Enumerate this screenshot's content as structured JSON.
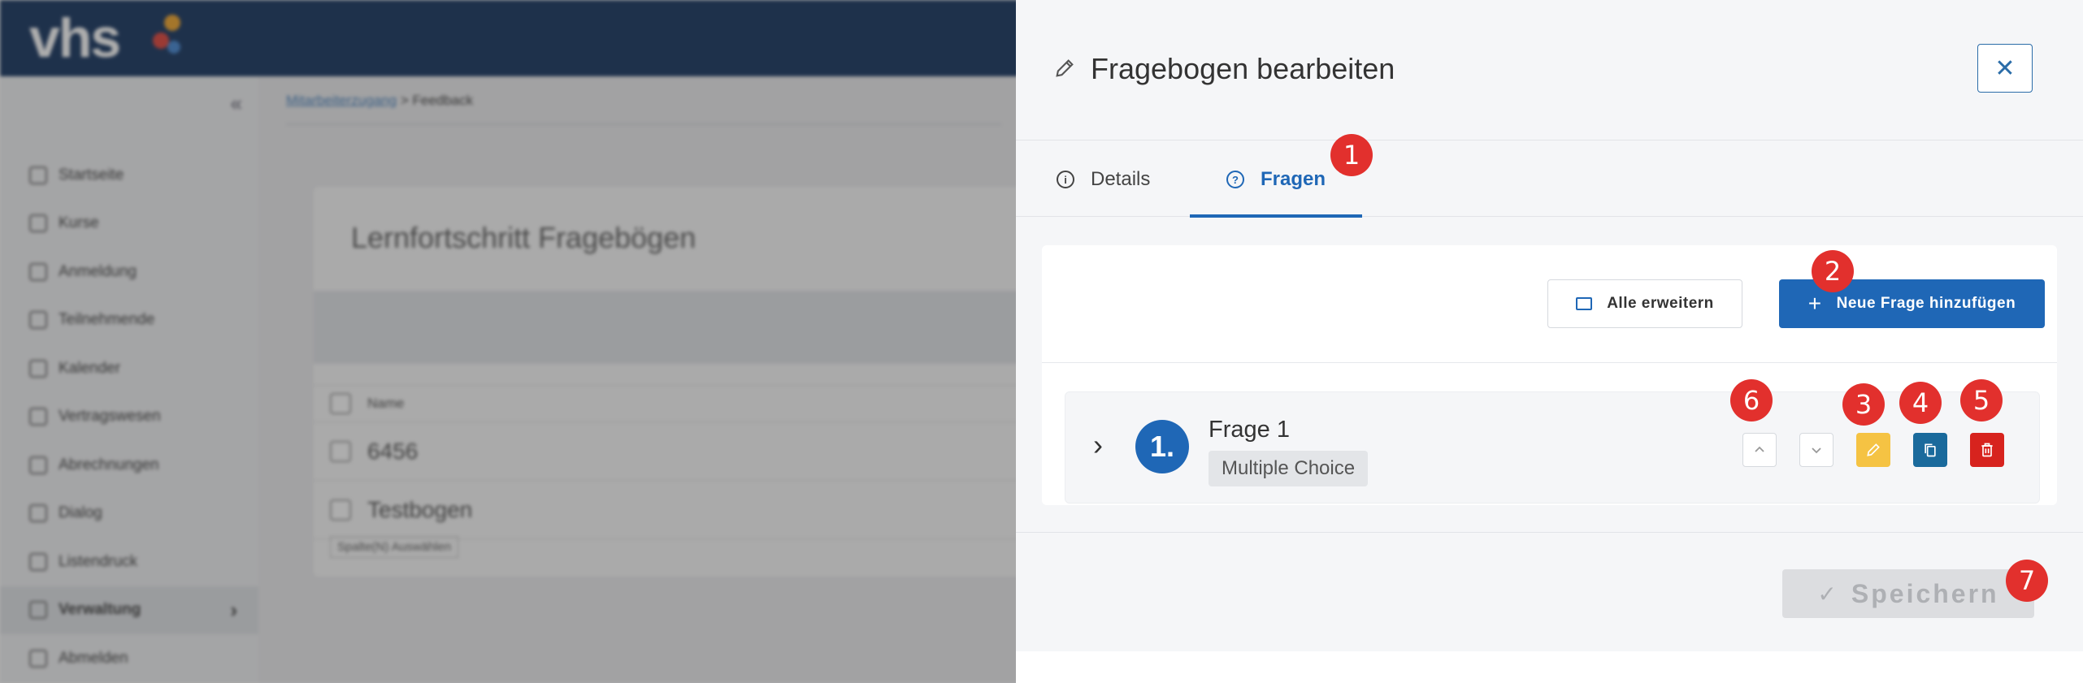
{
  "background": {
    "logo": "vhs",
    "breadcrumb": {
      "parent": "Mitarbeiterzugang",
      "separator": ">",
      "current": "Feedback"
    },
    "sidebar": [
      {
        "label": "Startseite",
        "active": false
      },
      {
        "label": "Kurse",
        "active": false
      },
      {
        "label": "Anmeldung",
        "active": false
      },
      {
        "label": "Teilnehmende",
        "active": false
      },
      {
        "label": "Kalender",
        "active": false
      },
      {
        "label": "Vertragswesen",
        "active": false
      },
      {
        "label": "Abrechnungen",
        "active": false
      },
      {
        "label": "Dialog",
        "active": false
      },
      {
        "label": "Listendruck",
        "active": false
      },
      {
        "label": "Verwaltung",
        "active": true
      },
      {
        "label": "Abmelden",
        "active": false
      }
    ],
    "card_title": "Lernfortschritt Fragebögen",
    "table": {
      "header": "Name",
      "rows": [
        "6456",
        "Testbogen"
      ],
      "footer": "Spalte(N) Auswählen"
    }
  },
  "panel": {
    "title": "Fragebogen bearbeiten",
    "close_symbol": "✕",
    "tabs": {
      "details": "Details",
      "fragen": "Fragen"
    },
    "buttons": {
      "expand_all": "Alle erweitern",
      "add_question": "Neue Frage hinzufügen",
      "save": "Speichern"
    },
    "question": {
      "number": "1.",
      "title": "Frage 1",
      "type": "Multiple Choice"
    }
  },
  "annotations": [
    "1",
    "2",
    "3",
    "4",
    "5",
    "6",
    "7"
  ],
  "colors": {
    "primary": "#1f67b6",
    "edit": "#f5c343",
    "copy": "#1a6a9c",
    "delete": "#d7231e",
    "badge": "#e2302d",
    "topbar": "#0a2a57"
  }
}
